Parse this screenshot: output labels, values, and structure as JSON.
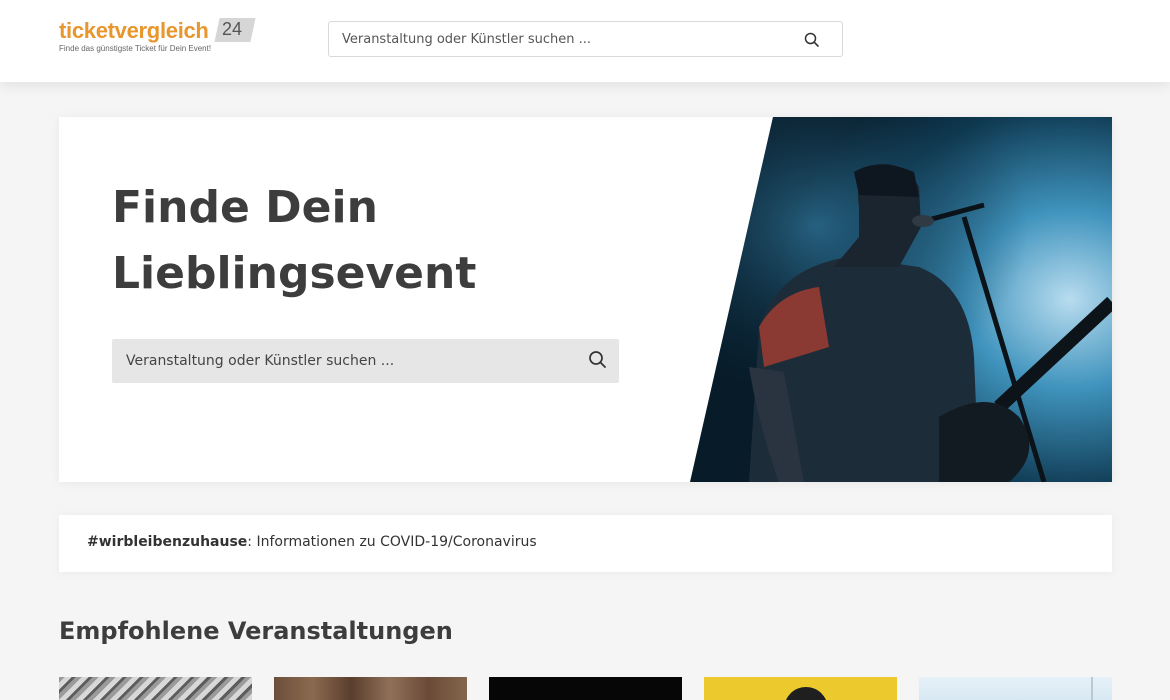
{
  "header": {
    "logo": {
      "name": "ticketvergleich",
      "number": "24",
      "tagline": "Finde das günstigste Ticket für Dein Event!"
    },
    "search": {
      "placeholder": "Veranstaltung oder Künstler suchen ...",
      "icon": "search-icon"
    }
  },
  "hero": {
    "title_line1": "Finde Dein",
    "title_line2": "Lieblingsevent",
    "search": {
      "placeholder": "Veranstaltung oder Künstler suchen ...",
      "icon": "search-icon"
    },
    "image": "concert-guitarist-photo"
  },
  "info_bar": {
    "hashtag": "#wirbleibenzuhause",
    "text": ": Informationen zu COVID-19/Coronavirus"
  },
  "recommended": {
    "title": "Empfohlene Veranstaltungen",
    "cards": [
      {
        "image": "event-image-1"
      },
      {
        "image": "event-image-2"
      },
      {
        "image": "event-image-3"
      },
      {
        "image": "event-image-4"
      },
      {
        "image": "event-image-5"
      }
    ]
  },
  "colors": {
    "brand_orange": "#e8962e",
    "text_dark": "#3d3d3d",
    "background": "#f5f5f5"
  }
}
